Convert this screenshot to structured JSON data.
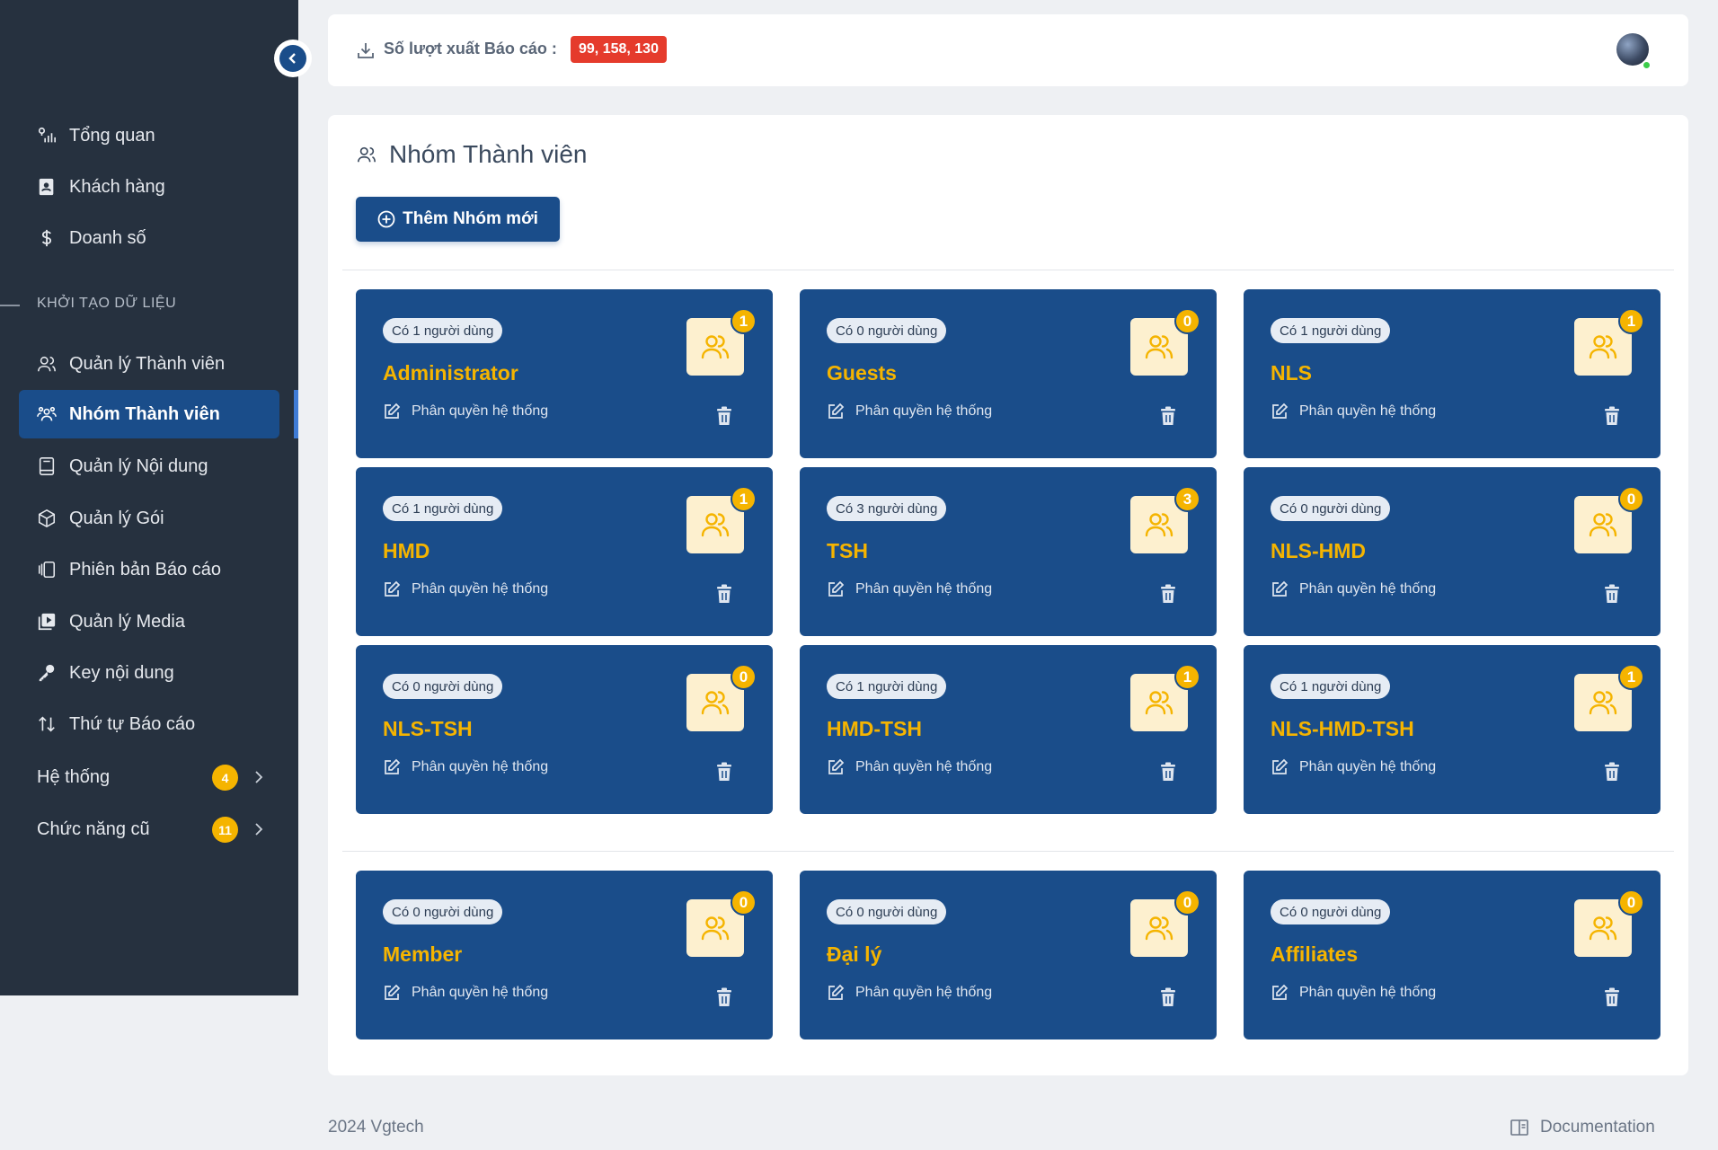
{
  "sidebar": {
    "items": [
      {
        "label": "Tổng quan",
        "icon": "dashboard-icon"
      },
      {
        "label": "Khách hàng",
        "icon": "contact-book-icon"
      },
      {
        "label": "Doanh số",
        "icon": "dollar-icon"
      }
    ],
    "section_label": "KHỞI TẠO DỮ LIỆU",
    "section_items": [
      {
        "label": "Quản lý Thành viên",
        "icon": "users-icon"
      },
      {
        "label": "Nhóm Thành viên",
        "icon": "user-group-icon",
        "active": true
      },
      {
        "label": "Quản lý Nội dung",
        "icon": "book-icon"
      },
      {
        "label": "Quản lý Gói",
        "icon": "package-icon"
      },
      {
        "label": "Phiên bản Báo cáo",
        "icon": "versions-icon"
      },
      {
        "label": "Quản lý Media",
        "icon": "media-icon"
      },
      {
        "label": "Key nội dung",
        "icon": "key-icon"
      },
      {
        "label": "Thứ tự Báo cáo",
        "icon": "sort-icon"
      }
    ],
    "groups": [
      {
        "label": "Hệ thống",
        "badge": "4"
      },
      {
        "label": "Chức năng cũ",
        "badge": "11"
      }
    ]
  },
  "topbar": {
    "export_label": "Số lượt xuất Báo cáo :",
    "export_count": "99, 158, 130"
  },
  "page": {
    "title": "Nhóm Thành viên",
    "add_button": "Thêm Nhóm mới"
  },
  "cards": [
    {
      "count_label": "Có 1 người dùng",
      "name": "Administrator",
      "badge": "1",
      "perm": "Phân quyền hệ thống"
    },
    {
      "count_label": "Có 0 người dùng",
      "name": "Guests",
      "badge": "0",
      "perm": "Phân quyền hệ thống"
    },
    {
      "count_label": "Có 1 người dùng",
      "name": "NLS",
      "badge": "1",
      "perm": "Phân quyền hệ thống"
    },
    {
      "count_label": "Có 1 người dùng",
      "name": "HMD",
      "badge": "1",
      "perm": "Phân quyền hệ thống"
    },
    {
      "count_label": "Có 3 người dùng",
      "name": "TSH",
      "badge": "3",
      "perm": "Phân quyền hệ thống"
    },
    {
      "count_label": "Có 0 người dùng",
      "name": "NLS-HMD",
      "badge": "0",
      "perm": "Phân quyền hệ thống"
    },
    {
      "count_label": "Có 0 người dùng",
      "name": "NLS-TSH",
      "badge": "0",
      "perm": "Phân quyền hệ thống"
    },
    {
      "count_label": "Có 1 người dùng",
      "name": "HMD-TSH",
      "badge": "1",
      "perm": "Phân quyền hệ thống"
    },
    {
      "count_label": "Có 1 người dùng",
      "name": "NLS-HMD-TSH",
      "badge": "1",
      "perm": "Phân quyền hệ thống"
    }
  ],
  "cards2": [
    {
      "count_label": "Có 0 người dùng",
      "name": "Member",
      "badge": "0",
      "perm": "Phân quyền hệ thống"
    },
    {
      "count_label": "Có 0 người dùng",
      "name": "Đại lý",
      "badge": "0",
      "perm": "Phân quyền hệ thống"
    },
    {
      "count_label": "Có 0 người dùng",
      "name": "Affiliates",
      "badge": "0",
      "perm": "Phân quyền hệ thống"
    }
  ],
  "footer": {
    "copyright": "2024 Vgtech",
    "doc_link": "Documentation"
  },
  "colors": {
    "sidebar_bg": "#26313f",
    "primary": "#1a4d8a",
    "accent": "#f5b400",
    "danger": "#e53b2c"
  }
}
